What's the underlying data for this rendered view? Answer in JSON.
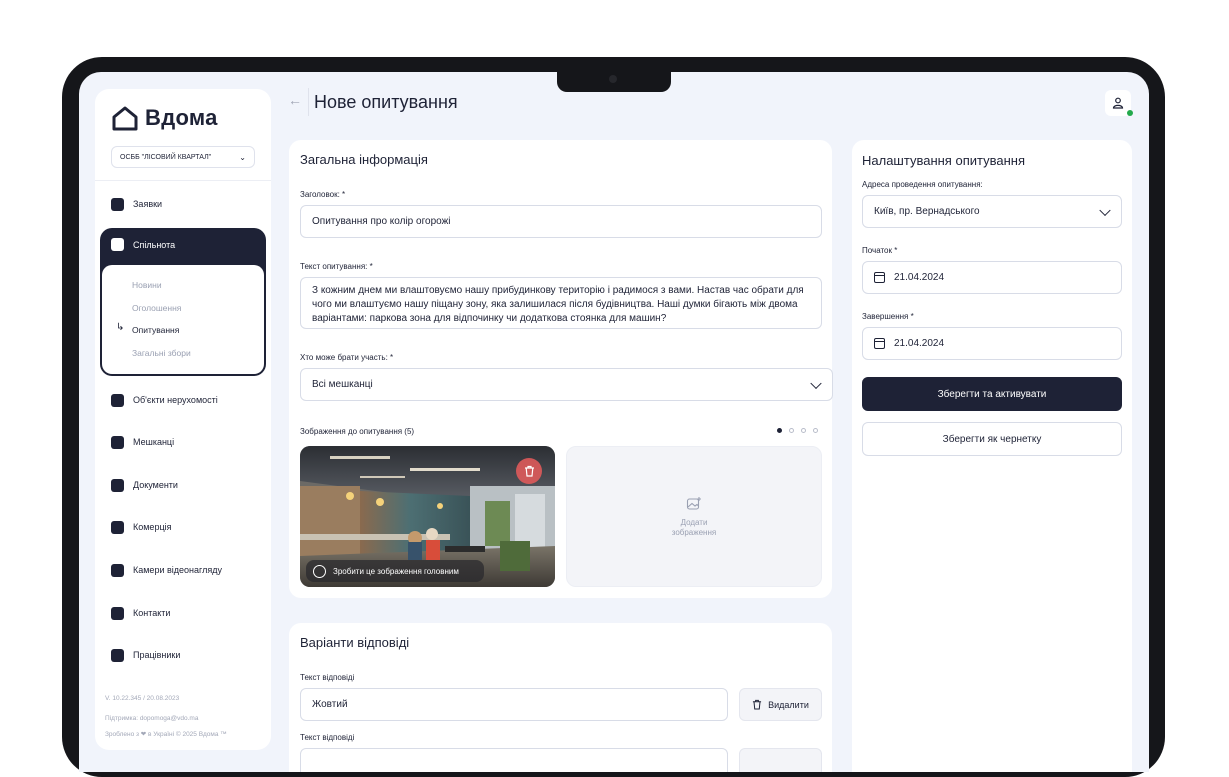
{
  "app": {
    "logo_text": "Вдома"
  },
  "sidebar": {
    "org": "ОСББ \"ЛІСОВИЙ КВАРТАЛ\"",
    "items": [
      {
        "label": "Заявки",
        "icon": "tasks-icon"
      },
      {
        "label": "Об'єкти нерухомості",
        "icon": "house-icon"
      },
      {
        "label": "Мешканці",
        "icon": "people-icon"
      },
      {
        "label": "Документи",
        "icon": "document-icon"
      },
      {
        "label": "Комерція",
        "icon": "wallet-icon"
      },
      {
        "label": "Камери відеонагляду",
        "icon": "camera-icon"
      },
      {
        "label": "Контакти",
        "icon": "contacts-icon"
      },
      {
        "label": "Працівники",
        "icon": "badge-icon"
      }
    ],
    "group": {
      "label": "Спільнота",
      "sub": [
        "Новини",
        "Оголошення",
        "Опитування",
        "Загальні збори"
      ]
    },
    "version": "V. 10.22.345 / 20.08.2023",
    "support": "Підтримка: dopomoga@vdo.ma",
    "made": "Зроблено з ❤ в Україні © 2025 Вдома ™"
  },
  "header": {
    "title": "Нове опитування"
  },
  "general": {
    "title": "Загальна інформація",
    "heading_label": "Заголовок: *",
    "heading_value": "Опитування про колір огорожі",
    "text_label": "Текст опитування: *",
    "text_value": "З кожним днем ми влаштовуємо нашу прибудинкову територію і радимося з вами. Настав час обрати для чого ми влаштуємо нашу піщану зону, яка залишилася після будівництва. Наші думки бігають між двома варіантами: паркова зона для відпочинку чи додаткова стоянка для машин?",
    "who_label": "Хто може брати участь: *",
    "who_value": "Всі мешканці",
    "images_label": "Зображення до опитування (5)",
    "make_main": "Зробити це зображення головним",
    "add_image": "Додати зображення"
  },
  "answers": {
    "title": "Варіанти відповіді",
    "answer_label": "Текст відповіді",
    "answer_value": "Жовтий",
    "delete_label": "Видалити"
  },
  "settings": {
    "title": "Налаштування опитування",
    "address_label": "Адреса проведення опитування:",
    "address_value": "Київ, пр. Вернадського",
    "start_label": "Початок *",
    "start_value": "21.04.2024",
    "end_label": "Завершення *",
    "end_value": "21.04.2024",
    "save_activate": "Зберегти та активувати",
    "save_draft": "Зберегти як чернетку"
  }
}
